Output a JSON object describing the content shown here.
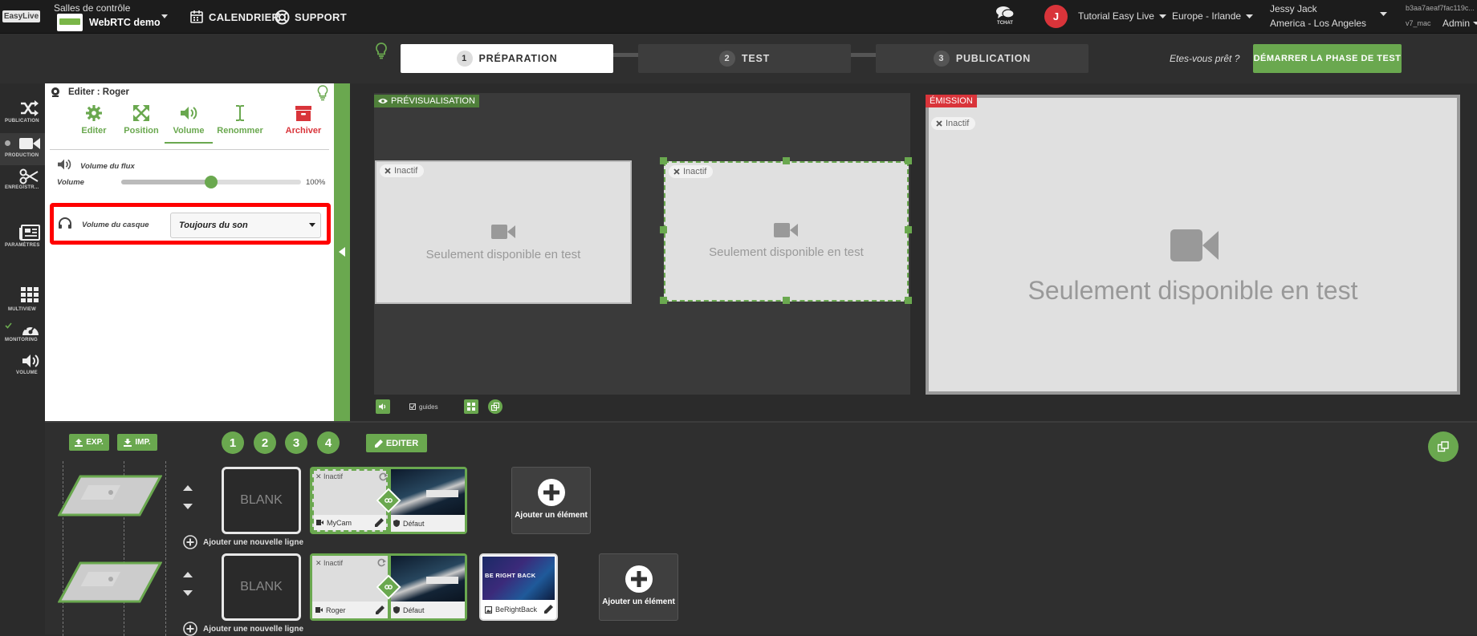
{
  "topbar": {
    "logo_text": "EasyLive",
    "control_room_label": "Salles de contrôle",
    "room_name": "WebRTC demo",
    "calendar": "CALENDRIER",
    "support": "SUPPORT",
    "chat": "TCHAT",
    "user_initial": "J",
    "tutorial": "Tutorial Easy Live",
    "region": "Europe - Irlande",
    "user_name": "Jessy Jack",
    "timezone": "America - Los Angeles",
    "session_id": "b3aa7aeaf7fac119c...",
    "version": "v7_mac",
    "role": "Admin"
  },
  "phases": [
    {
      "num": "1",
      "label": "PRÉPARATION"
    },
    {
      "num": "2",
      "label": "TEST"
    },
    {
      "num": "3",
      "label": "PUBLICATION"
    }
  ],
  "ready_text": "Etes-vous prêt ?",
  "start_button": "DÉMARRER LA PHASE DE TEST",
  "rail": [
    {
      "label": "PUBLICATION"
    },
    {
      "label": "PRODUCTION"
    },
    {
      "label": "ENREGISTR..."
    },
    {
      "label": "PARAMÈTRES"
    },
    {
      "label": "MULTIVIEW"
    },
    {
      "label": "MONITORING"
    },
    {
      "label": "VOLUME"
    }
  ],
  "editor": {
    "title": "Editer : Roger",
    "tools": [
      {
        "label": "Editer"
      },
      {
        "label": "Position"
      },
      {
        "label": "Volume"
      },
      {
        "label": "Renommer"
      },
      {
        "label": "Archiver"
      }
    ],
    "flux_volume_label": "Volume du flux",
    "volume_label": "Volume",
    "volume_value": "100%",
    "volume_level": 0.5,
    "headset_label": "Volume du casque",
    "headset_select": "Toujours du son"
  },
  "preview": {
    "tag": "PRÉVISUALISATION",
    "inactive": "Inactif",
    "unavailable": "Seulement disponible en test",
    "guides": "guides"
  },
  "emission": {
    "tag": "ÉMISSION",
    "inactive": "Inactif",
    "unavailable": "Seulement disponible en test"
  },
  "bottom": {
    "exp": "EXP.",
    "imp": "IMP.",
    "layouts": [
      "1",
      "2",
      "3",
      "4"
    ],
    "edit": "EDITER",
    "blank": "BLANK",
    "add_element": "Ajouter un élément",
    "add_line": "Ajouter une nouvelle ligne",
    "row1": {
      "cam_name": "MyCam",
      "inactive": "Inactif",
      "default": "Défaut"
    },
    "row2": {
      "cam_name": "Roger",
      "inactive": "Inactif",
      "default": "Défaut",
      "brb_thumb": "BE RIGHT BACK",
      "brb_label": "BeRightBack"
    }
  },
  "colors": {
    "accent": "#6aa84f",
    "danger": "#d9343a",
    "highlight": "#ff0000"
  }
}
